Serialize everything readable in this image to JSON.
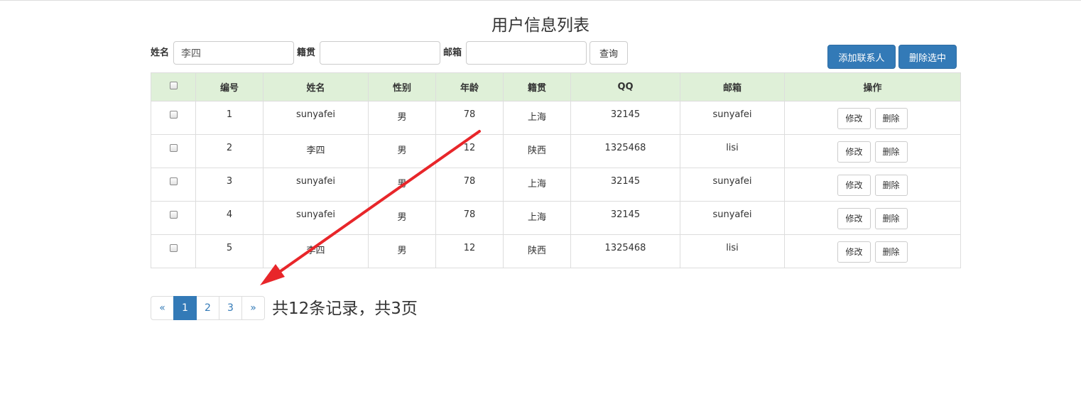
{
  "page": {
    "title": "用户信息列表"
  },
  "search": {
    "name_label": "姓名",
    "name_value": "李四",
    "origin_label": "籍贯",
    "origin_value": "",
    "email_label": "邮箱",
    "email_value": "",
    "query_button": "查询"
  },
  "actions": {
    "add_contact": "添加联系人",
    "delete_selected": "删除选中"
  },
  "table": {
    "headers": [
      "",
      "编号",
      "姓名",
      "性别",
      "年龄",
      "籍贯",
      "QQ",
      "邮箱",
      "操作"
    ],
    "rows": [
      {
        "id": "1",
        "name": "sunyafei",
        "gender": "男",
        "age": "78",
        "origin": "上海",
        "qq": "32145",
        "email": "sunyafei"
      },
      {
        "id": "2",
        "name": "李四",
        "gender": "男",
        "age": "12",
        "origin": "陕西",
        "qq": "1325468",
        "email": "lisi"
      },
      {
        "id": "3",
        "name": "sunyafei",
        "gender": "男",
        "age": "78",
        "origin": "上海",
        "qq": "32145",
        "email": "sunyafei"
      },
      {
        "id": "4",
        "name": "sunyafei",
        "gender": "男",
        "age": "78",
        "origin": "上海",
        "qq": "32145",
        "email": "sunyafei"
      },
      {
        "id": "5",
        "name": "李四",
        "gender": "男",
        "age": "12",
        "origin": "陕西",
        "qq": "1325468",
        "email": "lisi"
      }
    ],
    "edit_label": "修改",
    "delete_label": "删除"
  },
  "pagination": {
    "prev": "«",
    "pages": [
      "1",
      "2",
      "3"
    ],
    "active_page": "1",
    "next": "»",
    "summary": "共12条记录，共3页"
  },
  "colors": {
    "primary": "#337ab7",
    "header_bg": "#dff0d8",
    "annotation_arrow": "#e8262a"
  }
}
